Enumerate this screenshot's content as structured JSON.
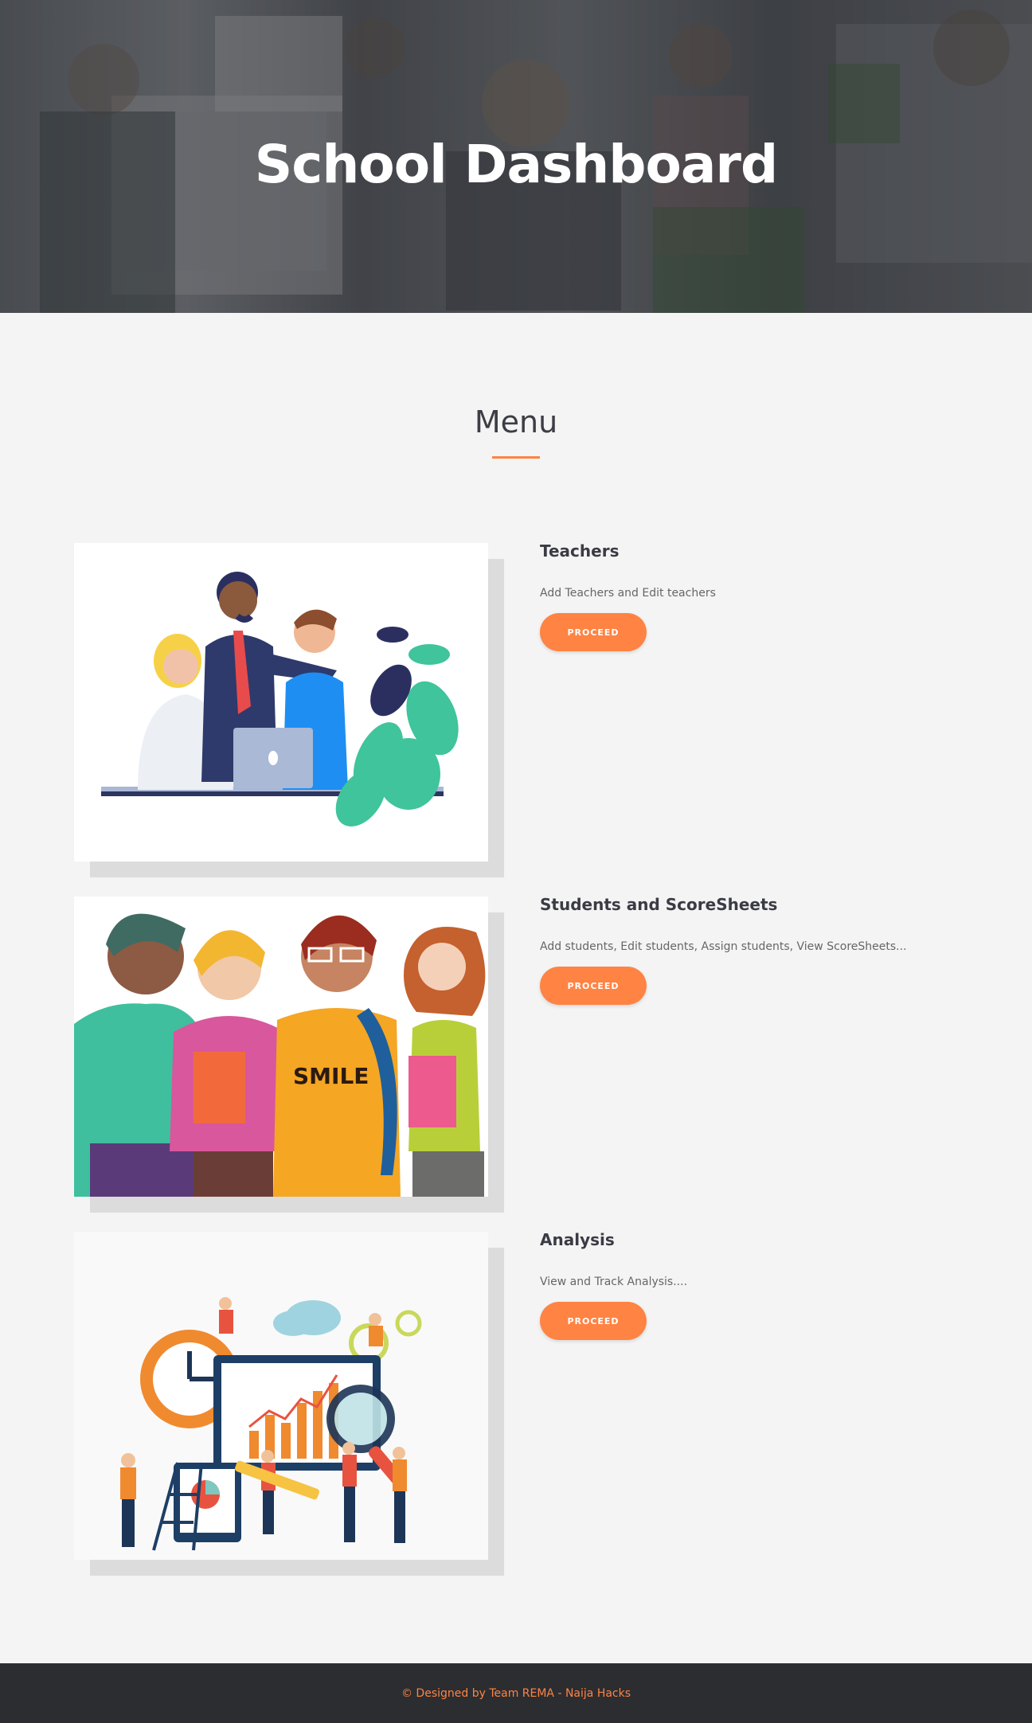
{
  "hero": {
    "title": "School Dashboard"
  },
  "menu": {
    "heading": "Menu"
  },
  "items": [
    {
      "title": "Teachers",
      "description": "Add Teachers and Edit teachers",
      "button": "PROCEED"
    },
    {
      "title": "Students and ScoreSheets",
      "description": "Add students, Edit students, Assign students, View ScoreSheets...",
      "button": "PROCEED"
    },
    {
      "title": "Analysis",
      "description": "View and Track Analysis....",
      "button": "PROCEED"
    }
  ],
  "footer": {
    "text": "© Designed by Team REMA - Naija Hacks"
  },
  "colors": {
    "accent": "#ff8343",
    "footer_bg": "#2b2d31",
    "page_bg": "#f4f4f4"
  }
}
